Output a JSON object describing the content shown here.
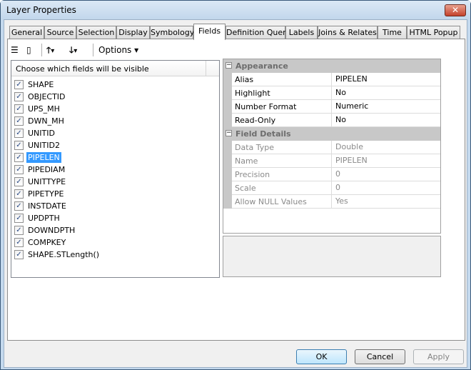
{
  "window": {
    "title": "Layer Properties",
    "close_icon": "close-icon"
  },
  "tabs": [
    {
      "label": "General"
    },
    {
      "label": "Source"
    },
    {
      "label": "Selection"
    },
    {
      "label": "Display"
    },
    {
      "label": "Symbology"
    },
    {
      "label": "Fields",
      "active": true
    },
    {
      "label": "Definition Query"
    },
    {
      "label": "Labels"
    },
    {
      "label": "Joins & Relates"
    },
    {
      "label": "Time"
    },
    {
      "label": "HTML Popup"
    }
  ],
  "toolbar": {
    "options_label": "Options",
    "icons": [
      "list-view-icon",
      "table-view-icon",
      "move-up-icon",
      "move-down-icon"
    ]
  },
  "fields_list": {
    "header": "Choose which fields will be visible",
    "items": [
      {
        "label": "SHAPE",
        "checked": true
      },
      {
        "label": "OBJECTID",
        "checked": true
      },
      {
        "label": "UPS_MH",
        "checked": true
      },
      {
        "label": "DWN_MH",
        "checked": true
      },
      {
        "label": "UNITID",
        "checked": true
      },
      {
        "label": "UNITID2",
        "checked": true
      },
      {
        "label": "PIPELEN",
        "checked": true,
        "selected": true
      },
      {
        "label": "PIPEDIAM",
        "checked": true
      },
      {
        "label": "UNITTYPE",
        "checked": true
      },
      {
        "label": "PIPETYPE",
        "checked": true
      },
      {
        "label": "INSTDATE",
        "checked": true
      },
      {
        "label": "UPDPTH",
        "checked": true
      },
      {
        "label": "DOWNDPTH",
        "checked": true
      },
      {
        "label": "COMPKEY",
        "checked": true
      },
      {
        "label": "SHAPE.STLength()",
        "checked": true
      }
    ]
  },
  "properties": {
    "appearance": {
      "title": "Appearance",
      "rows": [
        {
          "name": "Alias",
          "value": "PIPELEN"
        },
        {
          "name": "Highlight",
          "value": "No"
        },
        {
          "name": "Number Format",
          "value": "Numeric"
        },
        {
          "name": "Read-Only",
          "value": "No"
        }
      ]
    },
    "field_details": {
      "title": "Field Details",
      "rows": [
        {
          "name": "Data Type",
          "value": "Double"
        },
        {
          "name": "Name",
          "value": "PIPELEN"
        },
        {
          "name": "Precision",
          "value": "0"
        },
        {
          "name": "Scale",
          "value": "0"
        },
        {
          "name": "Allow NULL Values",
          "value": "Yes"
        }
      ]
    }
  },
  "buttons": {
    "ok": "OK",
    "cancel": "Cancel",
    "apply": "Apply"
  }
}
